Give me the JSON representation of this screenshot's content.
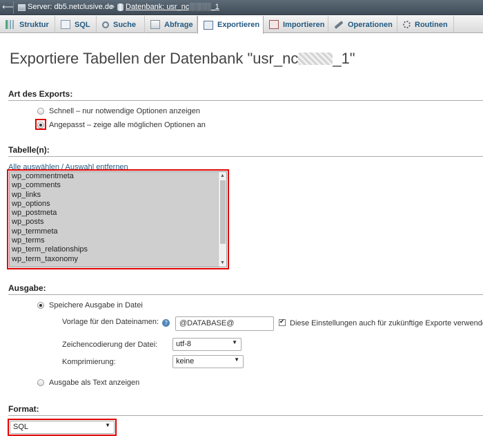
{
  "breadcrumb": {
    "server": "Server: db5.netclusive.de",
    "separator": "»",
    "database": "Datenbank: usr_nc░░░░_1"
  },
  "tabs": [
    {
      "label": "Struktur",
      "icon": "structure-icon"
    },
    {
      "label": "SQL",
      "icon": "sql-icon"
    },
    {
      "label": "Suche",
      "icon": "search-icon"
    },
    {
      "label": "Abfrage",
      "icon": "query-icon"
    },
    {
      "label": "Exportieren",
      "icon": "export-icon",
      "active": true
    },
    {
      "label": "Importieren",
      "icon": "import-icon"
    },
    {
      "label": "Operationen",
      "icon": "wrench-icon"
    },
    {
      "label": "Routinen",
      "icon": "routines-icon"
    }
  ],
  "title": {
    "prefix": "Exportiere Tabellen der Datenbank \"usr_nc",
    "suffix": "_1\""
  },
  "export_type": {
    "heading": "Art des Exports:",
    "options": [
      {
        "label": "Schnell – nur notwendige Optionen anzeigen",
        "selected": false
      },
      {
        "label": "Angepasst – zeige alle möglichen Optionen an",
        "selected": true
      }
    ]
  },
  "tables": {
    "heading": "Tabelle(n):",
    "select_all": "Alle auswählen / Auswahl entfernen",
    "items": [
      "wp_commentmeta",
      "wp_comments",
      "wp_links",
      "wp_options",
      "wp_postmeta",
      "wp_posts",
      "wp_termmeta",
      "wp_terms",
      "wp_term_relationships",
      "wp_term_taxonomy"
    ]
  },
  "output": {
    "heading": "Ausgabe:",
    "save_as_file": "Speichere Ausgabe in Datei",
    "filename_label": "Vorlage für den Dateinamen:",
    "filename_value": "@DATABASE@",
    "remember_label": "Diese Einstellungen auch für zukünftige Exporte verwenden",
    "charset_label": "Zeichencodierung der Datei:",
    "charset_value": "utf-8",
    "compression_label": "Komprimierung:",
    "compression_value": "keine",
    "as_text": "Ausgabe als Text anzeigen"
  },
  "format": {
    "heading": "Format:",
    "value": "SQL"
  },
  "colors": {
    "highlight": "#e00000",
    "link": "#235a81"
  }
}
